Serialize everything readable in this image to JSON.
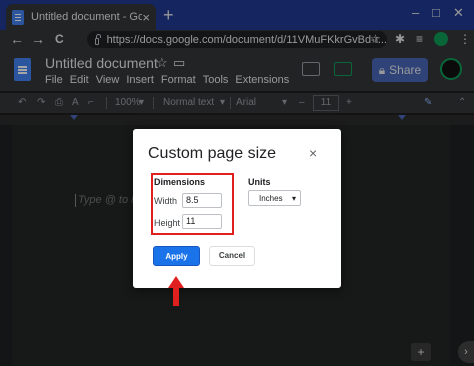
{
  "browser": {
    "tab_title": "Untitled document - Google Doc",
    "tab_close": "×",
    "new_tab": "+",
    "minimize": "–",
    "maximize": "□",
    "close": "✕",
    "url": "https://docs.google.com/document/d/11VMuFKkrGvBd-r...",
    "back": "←",
    "forward": "→",
    "reload": "C"
  },
  "docs": {
    "title": "Untitled document",
    "menu": [
      "File",
      "Edit",
      "View",
      "Insert",
      "Format",
      "Tools",
      "Extensions"
    ],
    "share_label": "Share",
    "toolbar": {
      "zoom": "100%",
      "style": "Normal text",
      "font": "Arial",
      "font_size": "11",
      "minus": "–",
      "plus": "+"
    },
    "placeholder": "Type @ to ins"
  },
  "dialog": {
    "title": "Custom page size",
    "close": "×",
    "dimensions_label": "Dimensions",
    "width_label": "Width",
    "width_value": "8.5",
    "height_label": "Height",
    "height_value": "11",
    "units_label": "Units",
    "units_value": "Inches",
    "apply_label": "Apply",
    "cancel_label": "Cancel"
  },
  "colors": {
    "annotation": "#e0201e",
    "primary": "#1a73e8",
    "tabstrip": "#1f3a93"
  }
}
